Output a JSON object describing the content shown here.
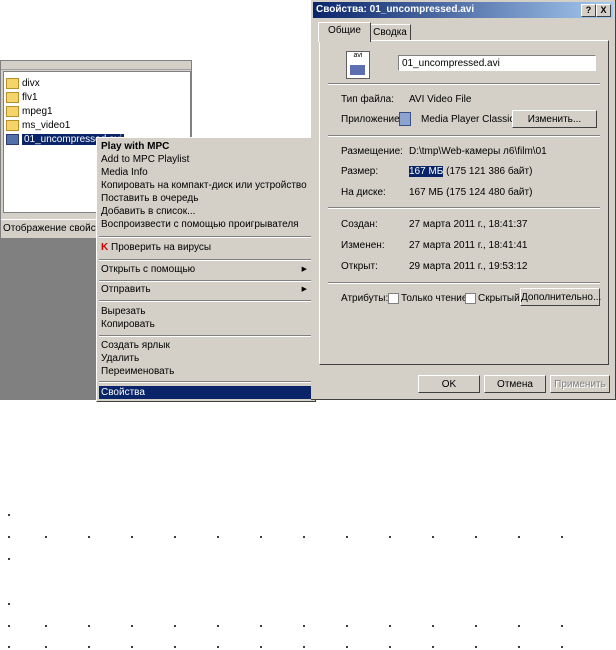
{
  "explorer": {
    "tree": [
      {
        "label": "divx"
      },
      {
        "label": "flv1"
      },
      {
        "label": "mpeg1"
      },
      {
        "label": "ms_video1"
      },
      {
        "label": "01_uncompressed.avi",
        "selected": true
      }
    ],
    "status": "Отображение свойств"
  },
  "context_menu": {
    "items": [
      {
        "label": "Play with MPC",
        "bold": true
      },
      {
        "label": "Add to MPC Playlist"
      },
      {
        "label": "Media Info"
      },
      {
        "label": "Копировать на компакт-диск или устройство"
      },
      {
        "label": "Поставить в очередь"
      },
      {
        "label": "Добавить в список..."
      },
      {
        "label": "Воспроизвести с помощью проигрывателя"
      },
      {
        "separator": true
      },
      {
        "label": "Проверить на вирусы",
        "icon": "kaspersky-icon"
      },
      {
        "separator": true
      },
      {
        "label": "Открыть с помощью",
        "submenu": true
      },
      {
        "separator": true
      },
      {
        "label": "Отправить",
        "submenu": true
      },
      {
        "separator": true
      },
      {
        "label": "Вырезать"
      },
      {
        "label": "Копировать"
      },
      {
        "separator": true
      },
      {
        "label": "Создать ярлык"
      },
      {
        "label": "Удалить"
      },
      {
        "label": "Переименовать"
      },
      {
        "separator": true
      },
      {
        "label": "Свойства",
        "selected": true
      }
    ]
  },
  "dialog": {
    "title": "Свойства: 01_uncompressed.avi",
    "help_btn": "?",
    "close_btn": "X",
    "tabs": [
      {
        "label": "Общие",
        "active": true
      },
      {
        "label": "Сводка"
      }
    ],
    "file_icon_text": "avi",
    "file_name": "01_uncompressed.avi",
    "type_label": "Тип файла:",
    "type_value": "AVI Video File",
    "app_label": "Приложение:",
    "app_value": "Media Player Classic -",
    "change_btn": "Изменить...",
    "location_label": "Размещение:",
    "location_value": "D:\\tmp\\Web-камеры л6\\film\\01",
    "size_label": "Размер:",
    "size_value_hl": "167 МБ",
    "size_value_rest": " (175 121 386 байт)",
    "disk_label": "На диске:",
    "disk_value": "167 МБ (175 124 480 байт)",
    "created_label": "Создан:",
    "created_value": "27 марта 2011 г., 18:41:37",
    "modified_label": "Изменен:",
    "modified_value": "27 марта 2011 г., 18:41:41",
    "opened_label": "Открыт:",
    "opened_value": "29 марта 2011 г., 19:53:12",
    "attr_label": "Атрибуты:",
    "readonly_label": "Только чтение",
    "hidden_label": "Скрытый",
    "advanced_btn": "Дополнительно...",
    "ok_btn": "OK",
    "cancel_btn": "Отмена",
    "apply_btn": "Применить"
  }
}
